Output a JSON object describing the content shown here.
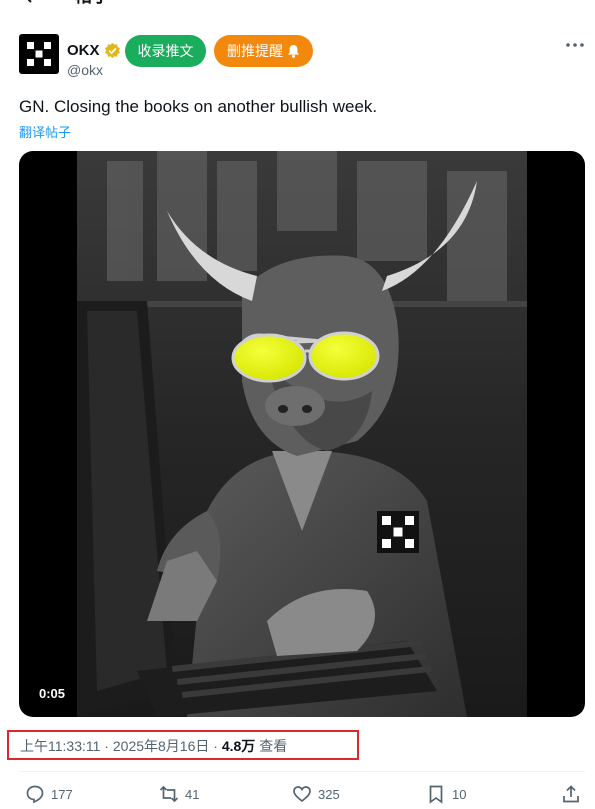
{
  "header": {
    "title": "帖子"
  },
  "author": {
    "name": "OKX",
    "handle": "@okx"
  },
  "buttons": {
    "collect": "收录推文",
    "delete_alert": "删推提醒"
  },
  "tweet": {
    "text": "GN. Closing the books on another bullish week.",
    "translate": "翻译帖子"
  },
  "media": {
    "timecode": "0:05"
  },
  "meta": {
    "time": "上午11:33:11",
    "date": "2025年8月16日",
    "views": "4.8万",
    "views_label": "查看"
  },
  "actions": {
    "replies": "177",
    "retweets": "41",
    "likes": "325",
    "bookmarks": "10"
  },
  "colors": {
    "accent": "#1d9bf0",
    "green_pill": "#1aad5e",
    "orange_pill": "#f2890d",
    "highlight_box": "#e0282c",
    "verified": "#e2b719"
  }
}
